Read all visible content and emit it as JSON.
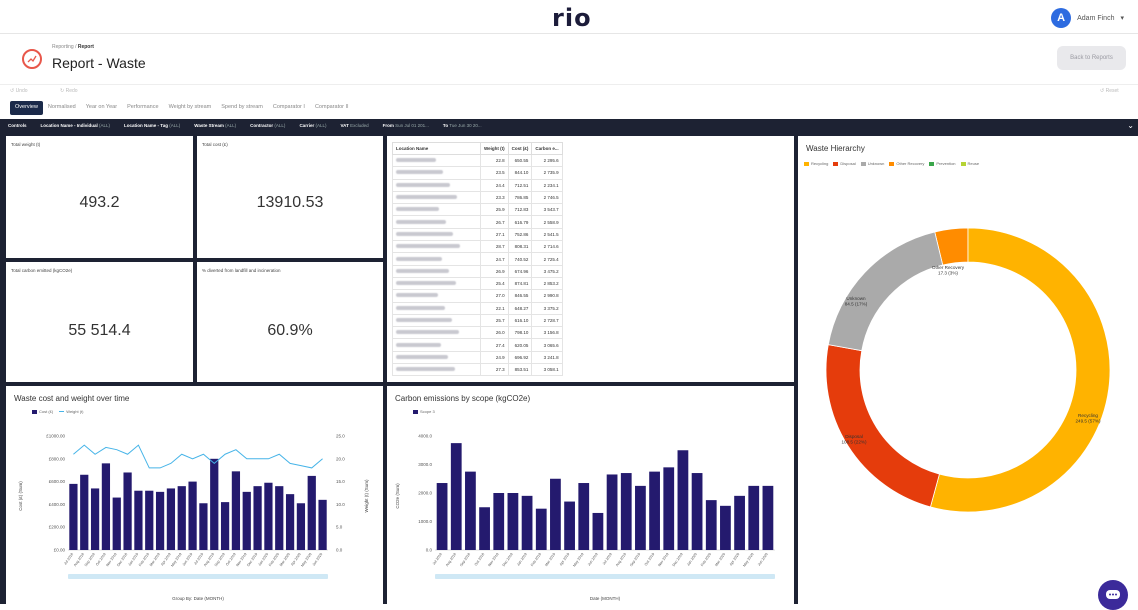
{
  "app": {
    "logo": "rio",
    "user_initial": "A",
    "user_name": "Adam Finch",
    "user_chevron": "▾"
  },
  "header": {
    "breadcrumb_parent": "Reporting",
    "breadcrumb_current": "Report",
    "title": "Report - Waste",
    "back_label": "Back to Reports"
  },
  "toolbar": {
    "undo": "Undo",
    "redo": "Redo",
    "reset": "Reset"
  },
  "tabs": [
    "Overview",
    "Normalised",
    "Year on Year",
    "Performance",
    "Weight by stream",
    "Spend by stream",
    "Comparator I",
    "Comparator II"
  ],
  "controls": {
    "label": "Controls",
    "f1_label": "Location Name - Individual",
    "f1_val": "(ALL)",
    "f2_label": "Location Name - Tag",
    "f2_val": "(ALL)",
    "f3_label": "Waste Stream",
    "f3_val": "(ALL)",
    "f4_label": "Contractor",
    "f4_val": "(ALL)",
    "f5_label": "Carrier",
    "f5_val": "(ALL)",
    "f6_label": "VAT",
    "f6_val": "Excluded",
    "f7_label": "From",
    "f7_val": "Sun Jul 01 201...",
    "f8_label": "To",
    "f8_val": "Tue Jun 30 20..."
  },
  "kpis": {
    "total_weight_label": "Total weight (t)",
    "total_weight": "493.2",
    "total_cost_label": "Total cost (£)",
    "total_cost": "13910.53",
    "carbon_label": "Total carbon emitted (kgCO2e)",
    "carbon": "55 514.4",
    "diverted_label": "% diverted from landfill and incineration",
    "diverted": "60.9%"
  },
  "table": {
    "headers": [
      "Location Name",
      "Weight (t)",
      "Cost (£)",
      "Carbon e..."
    ],
    "rows": [
      [
        "22.8",
        "650.55",
        "2 295.6"
      ],
      [
        "23.5",
        "844.10",
        "2 735.9"
      ],
      [
        "24.4",
        "712.51",
        "2 234.1"
      ],
      [
        "23.3",
        "786.85",
        "2 746.5"
      ],
      [
        "25.9",
        "712.83",
        "3 543.7"
      ],
      [
        "26.7",
        "616.79",
        "2 558.9"
      ],
      [
        "27.1",
        "752.86",
        "2 541.5"
      ],
      [
        "28.7",
        "808.31",
        "2 714.6"
      ],
      [
        "24.7",
        "740.52",
        "2 725.4"
      ],
      [
        "26.9",
        "674.96",
        "3 475.2"
      ],
      [
        "25.4",
        "874.81",
        "2 853.2"
      ],
      [
        "27.0",
        "846.55",
        "2 990.8"
      ],
      [
        "22.1",
        "648.27",
        "3 375.2"
      ],
      [
        "25.7",
        "616.10",
        "2 728.7"
      ],
      [
        "26.0",
        "798.10",
        "3 156.8"
      ],
      [
        "27.4",
        "620.05",
        "3 065.6"
      ],
      [
        "24.9",
        "696.92",
        "3 241.8"
      ],
      [
        "27.3",
        "853.51",
        "3 058.1"
      ]
    ]
  },
  "cost_chart": {
    "title": "Waste cost and weight over time",
    "legend_cost": "Cost (£)",
    "legend_weight": "Weight (t)",
    "left_ticks": [
      "£1000.00",
      "£800.00",
      "£600.00",
      "£400.00",
      "£200.00",
      "£0.00"
    ],
    "right_ticks": [
      "25.0",
      "20.0",
      "15.0",
      "10.0",
      "5.0",
      "0.0"
    ],
    "left_axis": "Cost (£) (Sum)",
    "right_axis": "Weight (t) (Sum)",
    "x_axis": "Group By: Date (MONTH)"
  },
  "carbon_chart": {
    "title": "Carbon emissions by scope (kgCO2e)",
    "legend": "Scope 3",
    "ticks": [
      "4000.0",
      "3000.0",
      "2000.0",
      "1000.0",
      "0.0"
    ],
    "y_axis": "CO2e (Sum)",
    "x_axis": "Date (MONTH)"
  },
  "hierarchy": {
    "title": "Waste Hierarchy",
    "legend": [
      "Recycling",
      "Disposal",
      "Unknown",
      "Other Recovery",
      "Prevention",
      "Reuse"
    ],
    "colors": [
      "#ffb300",
      "#e53c0c",
      "#aaaaaa",
      "#ff8c00",
      "#3aa64a",
      "#b5d334"
    ],
    "labels": {
      "recycling": "Recycling",
      "recycling_val": "249.5 (57%)",
      "disposal": "Disposal",
      "disposal_val": "108.5 (22%)",
      "unknown": "Unknown",
      "unknown_val": "84.5 (17%)",
      "other": "Other Recovery",
      "other_val": "17.3 (3%)"
    }
  },
  "chart_data": [
    {
      "type": "bar",
      "title": "Waste cost and weight over time",
      "xlabel": "Group By: Date (MONTH)",
      "ylabel": "Cost (£) (Sum)",
      "y2label": "Weight (t) (Sum)",
      "ylim": [
        0,
        1000
      ],
      "y2lim": [
        0,
        25
      ],
      "categories": [
        "Jul 2018",
        "Aug 2018",
        "Sep 2018",
        "Oct 2018",
        "Nov 2018",
        "Dec 2018",
        "Jan 2019",
        "Feb 2019",
        "Mar 2019",
        "Apr 2019",
        "May 2019",
        "Jun 2019",
        "Jul 2019",
        "Aug 2019",
        "Sep 2019",
        "Oct 2019",
        "Nov 2019",
        "Dec 2019",
        "Jan 2020",
        "Feb 2020",
        "Mar 2020",
        "Apr 2020",
        "May 2020",
        "Jun 2020"
      ],
      "series": [
        {
          "name": "Cost (£)",
          "type": "bar",
          "color": "#241a6e",
          "values": [
            580,
            660,
            540,
            760,
            460,
            680,
            520,
            520,
            510,
            540,
            560,
            600,
            410,
            800,
            420,
            690,
            510,
            560,
            590,
            560,
            490,
            410,
            650,
            440
          ]
        },
        {
          "name": "Weight (t)",
          "type": "line",
          "color": "#46b4e8",
          "axis": "right",
          "values": [
            21,
            23,
            21,
            22.5,
            22,
            21,
            23,
            18,
            18,
            19,
            21,
            20,
            21,
            19,
            21,
            22,
            20,
            20,
            20,
            21,
            19,
            18.5,
            18,
            20
          ]
        }
      ]
    },
    {
      "type": "bar",
      "title": "Carbon emissions by scope (kgCO2e)",
      "xlabel": "Date (MONTH)",
      "ylabel": "CO2e (Sum)",
      "ylim": [
        0,
        4000
      ],
      "categories": [
        "Jul 2018",
        "Aug 2018",
        "Sep 2018",
        "Oct 2018",
        "Nov 2018",
        "Dec 2018",
        "Jan 2019",
        "Feb 2019",
        "Mar 2019",
        "Apr 2019",
        "May 2019",
        "Jun 2019",
        "Jul 2019",
        "Aug 2019",
        "Sep 2019",
        "Oct 2019",
        "Nov 2019",
        "Dec 2019",
        "Jan 2020",
        "Feb 2020",
        "Mar 2020",
        "Apr 2020",
        "May 2020",
        "Jun 2020"
      ],
      "series": [
        {
          "name": "Scope 3",
          "color": "#241a6e",
          "values": [
            2350,
            3750,
            2750,
            1500,
            2000,
            2000,
            1900,
            1450,
            2500,
            1700,
            2350,
            1300,
            2650,
            2700,
            2250,
            2750,
            2900,
            3500,
            2700,
            1750,
            1550,
            1900,
            2250,
            2250
          ]
        }
      ]
    },
    {
      "type": "pie",
      "title": "Waste Hierarchy",
      "categories": [
        "Recycling",
        "Disposal",
        "Unknown",
        "Other Recovery",
        "Prevention",
        "Reuse"
      ],
      "values": [
        249.5,
        108.5,
        84.5,
        17.3,
        0,
        0
      ]
    }
  ]
}
